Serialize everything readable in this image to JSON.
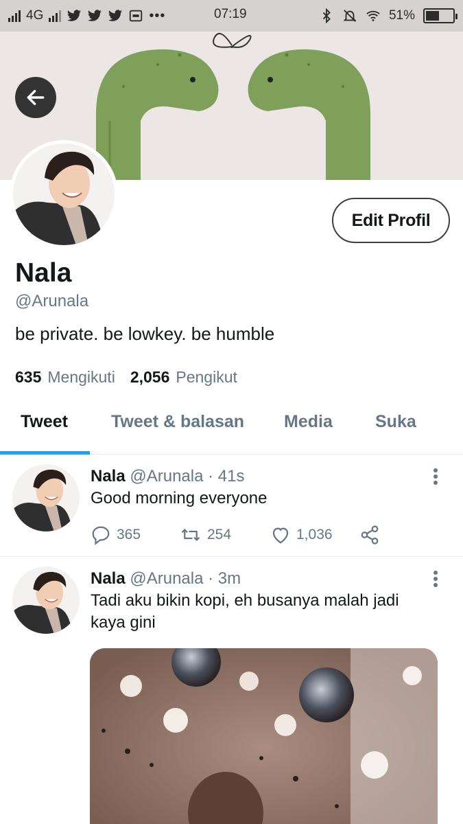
{
  "status_bar": {
    "network": "4G",
    "time": "07:19",
    "battery": "51%",
    "icons": [
      "signal-icon",
      "twitter-icon",
      "twitter-icon",
      "twitter-icon",
      "mail-icon",
      "more-icon",
      "bluetooth-icon",
      "silent-icon",
      "wifi-icon",
      "battery-icon"
    ]
  },
  "profile": {
    "edit_label": "Edit Profil",
    "name": "Nala",
    "handle": "@Arunala",
    "bio": "be private. be lowkey. be humble",
    "following_count": "635",
    "following_label": "Mengikuti",
    "followers_count": "2,056",
    "followers_label": "Pengikut"
  },
  "tabs": [
    {
      "label": "Tweet",
      "active": true
    },
    {
      "label": "Tweet & balasan",
      "active": false
    },
    {
      "label": "Media",
      "active": false
    },
    {
      "label": "Suka",
      "active": false
    }
  ],
  "tweets": [
    {
      "name": "Nala",
      "handle": "@Arunala",
      "time": "· 41s",
      "text": "Good morning everyone",
      "replies": "365",
      "retweets": "254",
      "likes": "1,036"
    },
    {
      "name": "Nala",
      "handle": "@Arunala",
      "time": "· 3m",
      "text": "Tadi aku bikin kopi, eh busanya malah jadi kaya gini"
    }
  ],
  "colors": {
    "accent": "#1da1f2",
    "secondary_text": "#657786",
    "banner_bg": "#ece6e5",
    "banner_plant": "#7fa05a"
  }
}
